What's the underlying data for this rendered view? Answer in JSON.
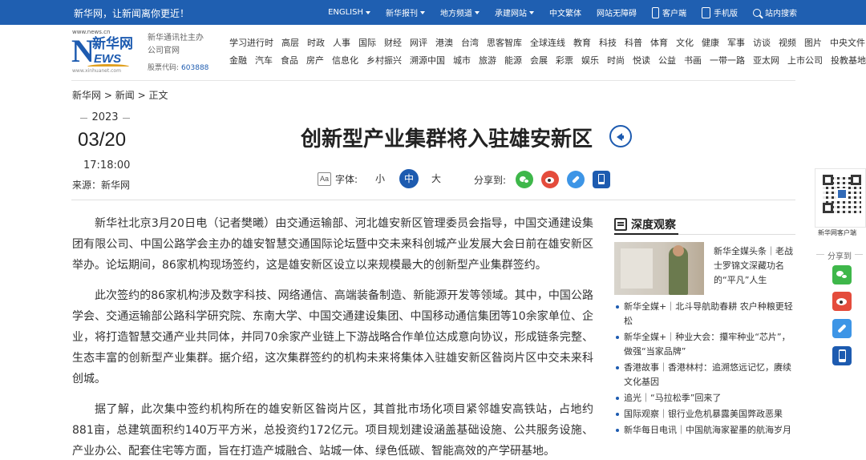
{
  "topbar": {
    "slogan": "新华网，让新闻离你更近！",
    "nav": [
      {
        "label": "ENGLISH",
        "dropdown": true
      },
      {
        "label": "新华报刊",
        "dropdown": true
      },
      {
        "label": "地方频道",
        "dropdown": true
      },
      {
        "label": "承建网站",
        "dropdown": true
      },
      {
        "label": "中文繁体",
        "dropdown": false
      },
      {
        "label": "网站无障碍",
        "dropdown": false
      }
    ],
    "client_label": "客户端",
    "tablet_label": "手机版",
    "search_label": "站内搜索"
  },
  "logo": {
    "domain": "www.news.cn",
    "cn": "新华网",
    "en_n": "N",
    "en_rest": "EWS",
    "url": "www.xinhuanet.com"
  },
  "header": {
    "official": "新华通讯社主办 公司官网",
    "stock_label": "股票代码:",
    "stock_code": "603888"
  },
  "channels": {
    "row1": [
      "学习进行时",
      "高层",
      "时政",
      "人事",
      "国际",
      "财经",
      "网评",
      "港澳",
      "台湾",
      "思客智库",
      "全球连线",
      "教育",
      "科技",
      "科普",
      "体育",
      "文化",
      "健康",
      "军事",
      "访谈",
      "视频",
      "图片",
      "中央文件"
    ],
    "row2": [
      "金融",
      "汽车",
      "食品",
      "房产",
      "信息化",
      "乡村振兴",
      "溯源中国",
      "城市",
      "旅游",
      "能源",
      "会展",
      "彩票",
      "娱乐",
      "时尚",
      "悦读",
      "公益",
      "书画",
      "一带一路",
      "亚太网",
      "上市公司",
      "投教基地"
    ]
  },
  "breadcrumb": {
    "home": "新华网",
    "section": "新闻",
    "current": "正文",
    "sep": ">"
  },
  "date": {
    "year": "2023",
    "day_month": "03/20",
    "time": "17:18:00",
    "source": "来源：新华网"
  },
  "article": {
    "title": "创新型产业集群将入驻雄安新区",
    "font_label": "字体:",
    "font_small": "小",
    "font_mid": "中",
    "font_large": "大",
    "share_label": "分享到:",
    "paragraphs": [
      "新华社北京3月20日电（记者樊曦）由交通运输部、河北雄安新区管理委员会指导，中国交通建设集团有限公司、中国公路学会主办的雄安智慧交通国际论坛暨中交未来科创城产业发展大会日前在雄安新区举办。论坛期间，86家机构现场签约，这是雄安新区设立以来规模最大的创新型产业集群签约。",
      "此次签约的86家机构涉及数字科技、网络通信、高端装备制造、新能源开发等领域。其中，中国公路学会、交通运输部公路科学研究院、东南大学、中国交通建设集团、中国移动通信集团等10余家单位、企业，将打造智慧交通产业共同体，并同70余家产业链上下游战略合作单位达成意向协议，形成链条完整、生态丰富的创新型产业集群。据介绍，这次集群签约的机构未来将集体入驻雄安新区昝岗片区中交未来科创城。",
      "据了解，此次集中签约机构所在的雄安新区昝岗片区，其首批市场化项目紧邻雄安高铁站，占地约881亩，总建筑面积约140万平方米，总投资约172亿元。项目规划建设涵盖基础设施、公共服务设施、产业办公、配套住宅等方面，旨在打造产城融合、站城一体、绿色低碳、智能高效的产学研基地。"
    ]
  },
  "sidebar": {
    "deep_title": "深度观察",
    "feature_text": "新华全媒头条｜老战士罗锦文深藏功名的“平凡”人生",
    "news": [
      "新华全媒+｜北斗导航助春耕 农户种粮更轻松",
      "新华全媒+｜种业大会：攥牢种业“芯片”，做强“当家品牌”",
      "香港故事｜香港林村：追溯悠远记忆，赓续文化基因",
      "追光｜“马拉松季”回来了",
      "国际观察｜银行业危机暴露美国弊政恶果",
      "新华每日电讯｜中国航海家翟墨的航海岁月"
    ]
  },
  "float_panel": {
    "client_label": "新华网客户端",
    "share_label": "分享到"
  },
  "colors": {
    "brand_blue": "#1f5fb1",
    "wechat": "#3eb74a",
    "weibo": "#e44c3c",
    "link": "#3d95e6"
  }
}
